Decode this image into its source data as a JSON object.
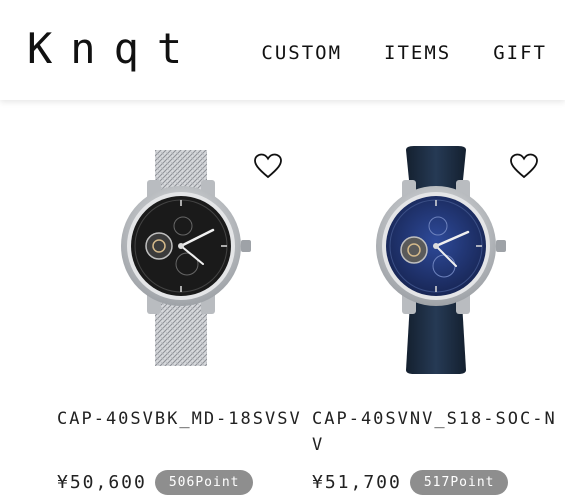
{
  "header": {
    "logo": "Knqt",
    "nav": [
      "CUSTOM",
      "ITEMS",
      "GIFT"
    ]
  },
  "products": [
    {
      "name": "CAP-40SVBK_MD-18SVSV",
      "price": "¥50,600",
      "points": "506Point",
      "dial_color": "#1a1a1a",
      "strap": "mesh"
    },
    {
      "name": "CAP-40SVNV_S18-SOC-NV",
      "price": "¥51,700",
      "points": "517Point",
      "dial_color": "#1d2f6b",
      "strap": "navy leather"
    }
  ],
  "colors": {
    "accent_point_badge": "#8e8e8e",
    "strap_navy": "#1e2d45",
    "steel": "#c9cbce"
  }
}
